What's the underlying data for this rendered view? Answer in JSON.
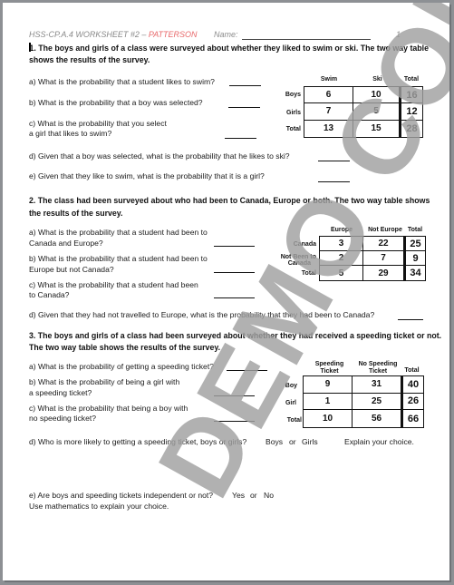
{
  "header": {
    "course_code": "HSS-CP.A.4 WORKSHEET #2 – ",
    "author": "PATTERSON",
    "name_label": "Name:",
    "page_number": "1"
  },
  "watermark": "DEMO COPY",
  "colors": {
    "header_gray": "#8a8a8a",
    "author_red": "#e8696b",
    "watermark_gray": "#a0a0a0"
  },
  "q1": {
    "number": "1.",
    "intro_line1": "The boys and girls of a class were surveyed about whether they liked to swim or ski.  The two way table",
    "intro_line2": "shows the results of the survey.",
    "parts": [
      {
        "label": "a) What is the probability that a student likes to swim?"
      },
      {
        "label": "b) What is the probability that a boy was selected?"
      },
      {
        "label_line1": "c) What is the probability that you select",
        "label_line2": "a girl that likes to swim?"
      },
      {
        "label": "d) Given that a boy was selected, what is the probability that he likes to ski?"
      },
      {
        "label": "e) Given that they like to swim, what is the probability that it is  a girl?"
      }
    ],
    "table": {
      "columns": [
        "Swim",
        "Ski",
        "Total"
      ],
      "rows": [
        {
          "label": "Boys",
          "values": [
            "6",
            "10",
            "16"
          ]
        },
        {
          "label": "Girls",
          "values": [
            "7",
            "5",
            "12"
          ]
        },
        {
          "label": "Total",
          "values": [
            "13",
            "15",
            "28"
          ]
        }
      ]
    }
  },
  "q2": {
    "intro_line1": "2. The class had been surveyed about who had been to Canada, Europe or both.  The two way table shows",
    "intro_line2": "the results of the survey.",
    "parts": [
      {
        "label_line1": "a) What is the probability that a student had been to",
        "label_line2": "Canada and Europe?"
      },
      {
        "label_line1": "b) What is the probability that a student had been to",
        "label_line2": "Europe but not Canada?"
      },
      {
        "label_line1": "c) What is the probability that a student had been",
        "label_line2": "to Canada?"
      },
      {
        "label": "d) Given that they had not travelled to Europe, what is the probability that they had been to Canada?"
      }
    ],
    "table": {
      "columns": [
        "Europe",
        "Not Europe",
        "Total"
      ],
      "rows": [
        {
          "label": "Canada",
          "values": [
            "3",
            "22",
            "25"
          ]
        },
        {
          "label_line1": "Not Been to",
          "label_line2": "Canada",
          "values": [
            "2",
            "7",
            "9"
          ]
        },
        {
          "label": "Total",
          "values": [
            "5",
            "29",
            "34"
          ]
        }
      ]
    }
  },
  "q3": {
    "intro_line1": "3. The boys and girls of a class had been surveyed about whether they had received a speeding ticket or not.",
    "intro_line2": "The two way table shows the results of the survey.",
    "parts": [
      {
        "label": "a) What is the probability of getting a speeding ticket?"
      },
      {
        "label_line1": "b) What is the probability of being a girl with",
        "label_line2": "a speeding ticket?"
      },
      {
        "label_line1": "c) What is the probability that being a boy with",
        "label_line2": "no speeding ticket?"
      },
      {
        "label": "d) Who is more likely to getting a speeding ticket, boys or girls?",
        "choice_a": "Boys",
        "or": "or",
        "choice_b": "Girls",
        "explain": "Explain your choice."
      },
      {
        "label": "e) Are boys and speeding tickets independent or not?",
        "choice_a": "Yes",
        "or": "or",
        "choice_b": "No",
        "explain": "Use mathematics to explain your choice."
      }
    ],
    "table": {
      "columns": [
        {
          "line1": "Speeding",
          "line2": "Ticket"
        },
        {
          "line1": "No Speeding",
          "line2": "Ticket"
        },
        {
          "line1": "Total",
          "line2": ""
        }
      ],
      "rows": [
        {
          "label": "Boy",
          "values": [
            "9",
            "31",
            "40"
          ]
        },
        {
          "label": "Girl",
          "values": [
            "1",
            "25",
            "26"
          ]
        },
        {
          "label": "Total",
          "values": [
            "10",
            "56",
            "66"
          ]
        }
      ]
    }
  }
}
